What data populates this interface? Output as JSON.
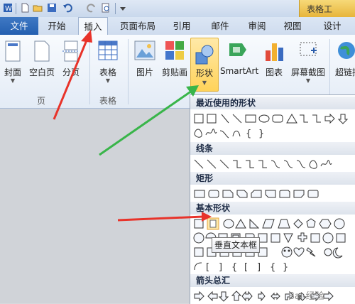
{
  "contextual_tab": "表格工",
  "tabs": [
    "文件",
    "开始",
    "插入",
    "页面布局",
    "引用",
    "邮件",
    "审阅",
    "视图",
    "设计"
  ],
  "ribbon": {
    "cover": "封面",
    "blank_page": "空白页",
    "page_break": "分页",
    "table": "表格",
    "picture": "图片",
    "clipart": "剪贴画",
    "shapes": "形状",
    "smartart": "SmartArt",
    "chart": "图表",
    "screenshot": "屏幕截图",
    "hyperlink": "超链接",
    "group_pages": "页",
    "group_tables": "表格"
  },
  "dropdown": {
    "recent": "最近使用的形状",
    "lines": "线条",
    "rectangles": "矩形",
    "basic": "基本形状",
    "arrows": "箭头总汇"
  },
  "tooltip": "垂直文本框",
  "watermark": "Bai 经验",
  "colors": {
    "file_tab": "#2b64b4",
    "highlight": "#ffd35a",
    "red_arrow": "#e8332a",
    "green_arrow": "#39b54a"
  }
}
